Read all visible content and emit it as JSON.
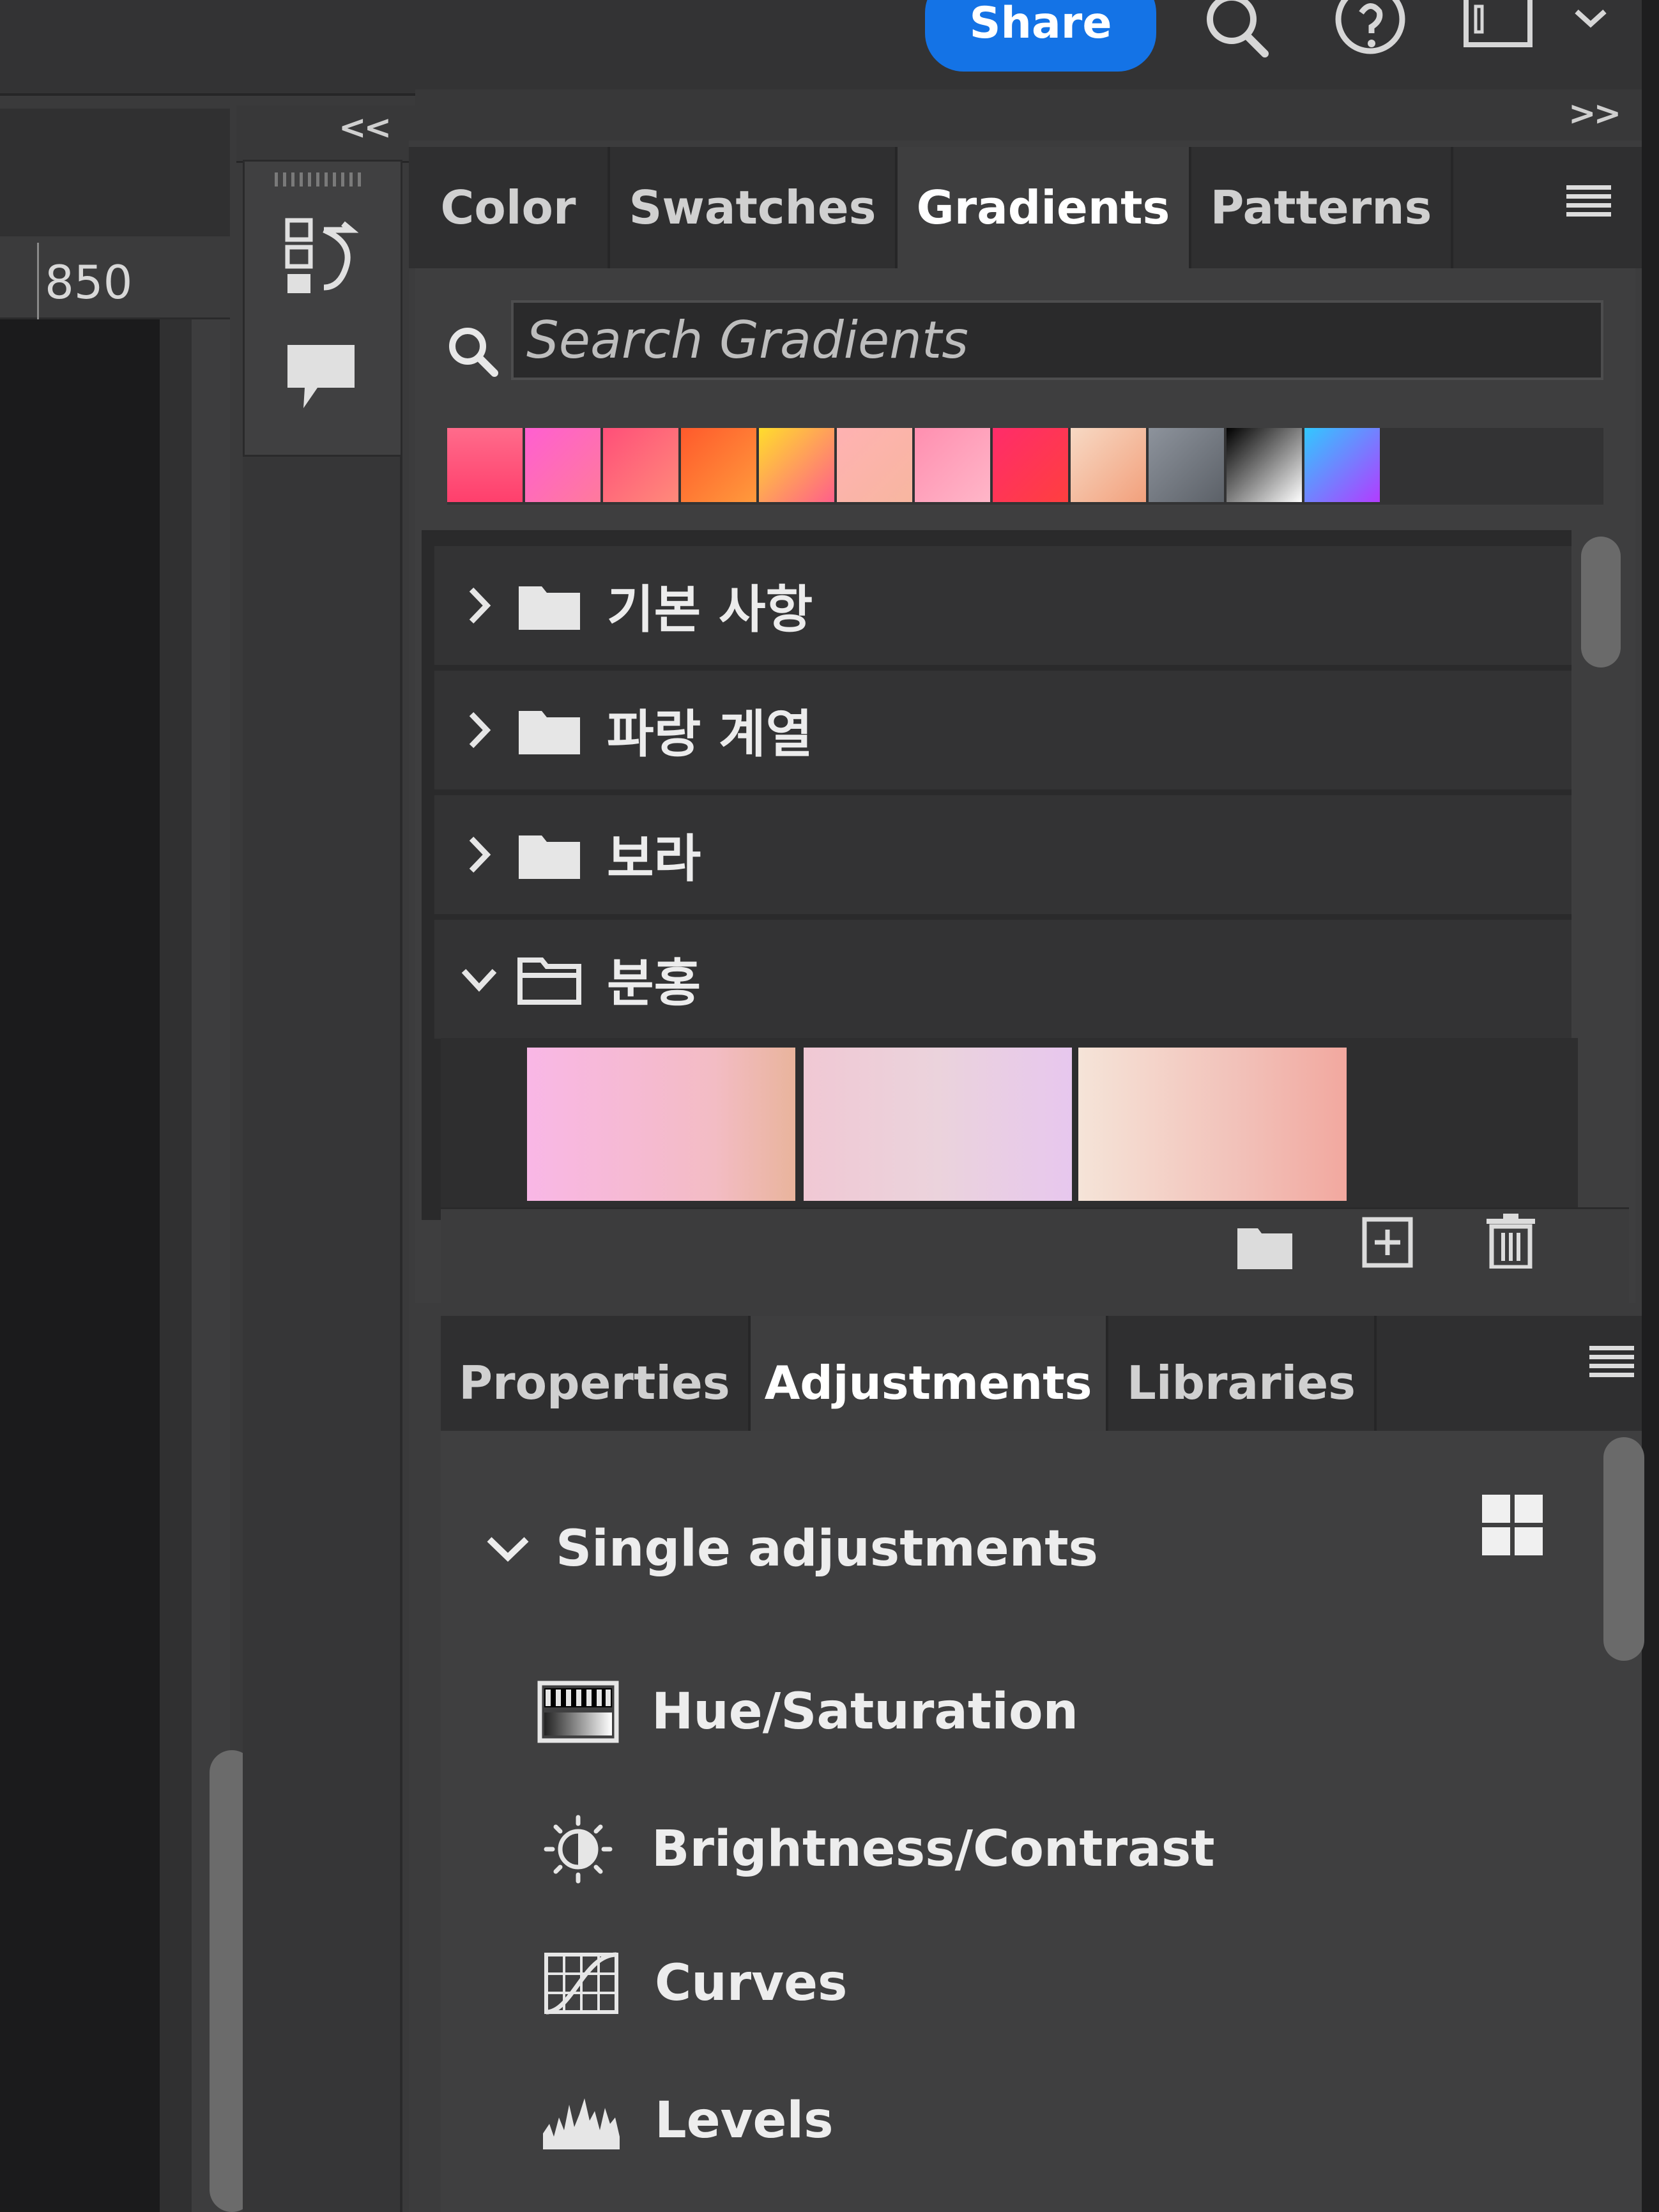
{
  "topbar": {
    "share_label": "Share"
  },
  "ruler": {
    "label": "850"
  },
  "gradients_panel": {
    "tabs": [
      {
        "label": "Color",
        "active": false
      },
      {
        "label": "Swatches",
        "active": false
      },
      {
        "label": "Gradients",
        "active": true
      },
      {
        "label": "Patterns",
        "active": false
      }
    ],
    "search_placeholder": "Search Gradients",
    "recent_swatches": [
      "linear-gradient(180deg,#ff6b8b,#ff3f6c)",
      "linear-gradient(135deg,#ff5fd1,#ff7a9c)",
      "linear-gradient(135deg,#ff4f79,#ff8a7a)",
      "linear-gradient(135deg,#ff5a2c,#ff9a3c)",
      "linear-gradient(135deg,#ffdd2c,#ff5f8a)",
      "linear-gradient(135deg,#ffb2b2,#f7b6a0)",
      "linear-gradient(135deg,#ff8fb0,#ffb6c8)",
      "linear-gradient(135deg,#ff2c6a,#ff3f3f)",
      "linear-gradient(135deg,#f7d9c4,#f2a07c)",
      "linear-gradient(135deg,#8d939c,#5c6168)",
      "linear-gradient(135deg,#000000,#ffffff)",
      "linear-gradient(135deg,#31c8ff,#b23cff)"
    ],
    "folders": [
      {
        "label": "기본 사항",
        "expanded": false
      },
      {
        "label": "파랑 계열",
        "expanded": false
      },
      {
        "label": "보라",
        "expanded": false
      },
      {
        "label": "분홍",
        "expanded": true
      }
    ],
    "pink_gradients": [
      "linear-gradient(90deg,#f9b7e6,#f3bcc4 70%,#e9b49c)",
      "linear-gradient(90deg,#f0c8d4,#ebd3dc 50%,#e7c7ee)",
      "linear-gradient(90deg,#f5e4d8,#f2c1b9 60%,#f2a89f)"
    ]
  },
  "adjustments_panel": {
    "tabs": [
      {
        "label": "Properties",
        "active": false
      },
      {
        "label": "Adjustments",
        "active": true
      },
      {
        "label": "Libraries",
        "active": false
      }
    ],
    "section_label": "Single adjustments",
    "items": [
      {
        "label": "Hue/Saturation",
        "icon": "hue-saturation-icon"
      },
      {
        "label": "Brightness/Contrast",
        "icon": "brightness-contrast-icon"
      },
      {
        "label": "Curves",
        "icon": "curves-icon"
      },
      {
        "label": "Levels",
        "icon": "levels-icon"
      }
    ]
  }
}
